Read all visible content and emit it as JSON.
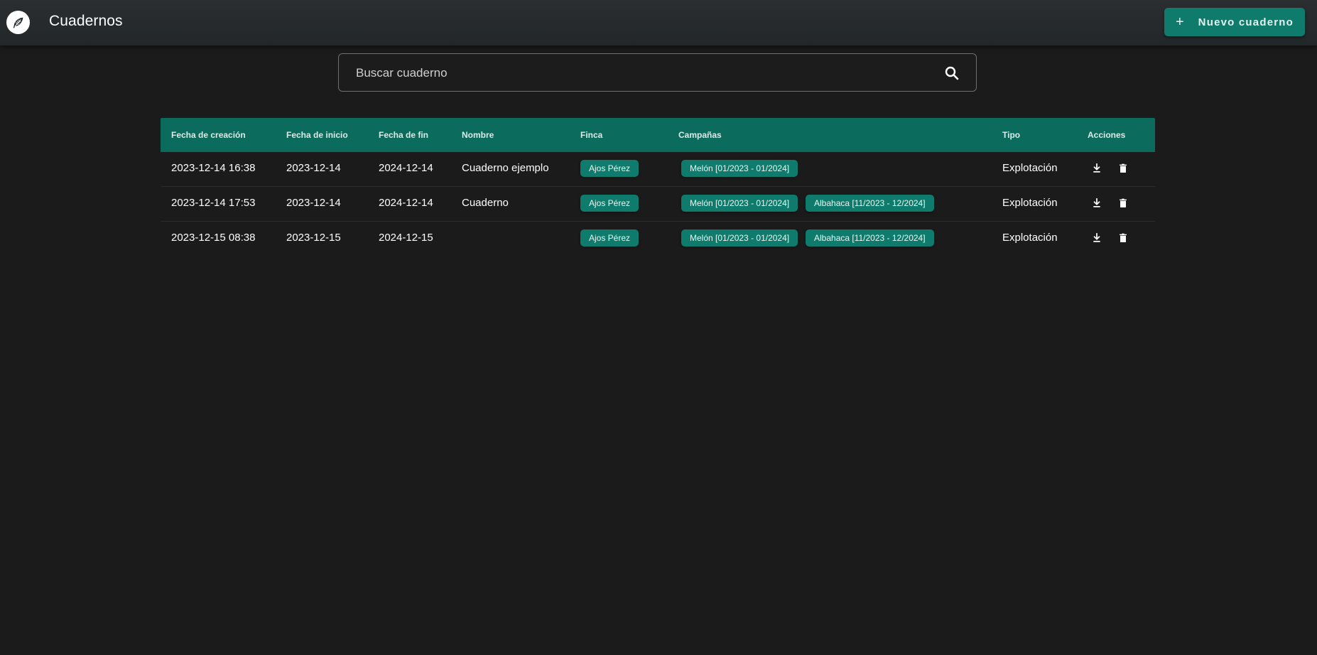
{
  "header": {
    "title": "Cuadernos",
    "new_button_label": "Nuevo cuaderno",
    "plus_glyph": "+",
    "logo_icon": "leaf-icon"
  },
  "search": {
    "placeholder": "Buscar cuaderno",
    "value": ""
  },
  "table": {
    "columns": [
      "Fecha de creación",
      "Fecha de inicio",
      "Fecha de fin",
      "Nombre",
      "Finca",
      "Campañas",
      "Tipo",
      "Acciones"
    ],
    "rows": [
      {
        "created": "2023-12-14 16:38",
        "start": "2023-12-14",
        "end": "2024-12-14",
        "name": "Cuaderno ejemplo",
        "farm": "Ajos Pérez",
        "campaigns": [
          "Melón [01/2023 - 01/2024]"
        ],
        "type": "Explotación"
      },
      {
        "created": "2023-12-14 17:53",
        "start": "2023-12-14",
        "end": "2024-12-14",
        "name": "Cuaderno",
        "farm": "Ajos Pérez",
        "campaigns": [
          "Melón [01/2023 - 01/2024]",
          "Albahaca [11/2023 - 12/2024]"
        ],
        "type": "Explotación"
      },
      {
        "created": "2023-12-15 08:38",
        "start": "2023-12-15",
        "end": "2024-12-15",
        "name": "",
        "farm": "Ajos Pérez",
        "campaigns": [
          "Melón [01/2023 - 01/2024]",
          "Albahaca [11/2023 - 12/2024]"
        ],
        "type": "Explotación"
      }
    ],
    "action_icons": [
      "download-icon",
      "delete-icon"
    ]
  },
  "colors": {
    "accent": "#0f7b6c",
    "header_row": "#0b6b5c",
    "background": "#1b1b1b",
    "topbar": "#262a2d"
  }
}
